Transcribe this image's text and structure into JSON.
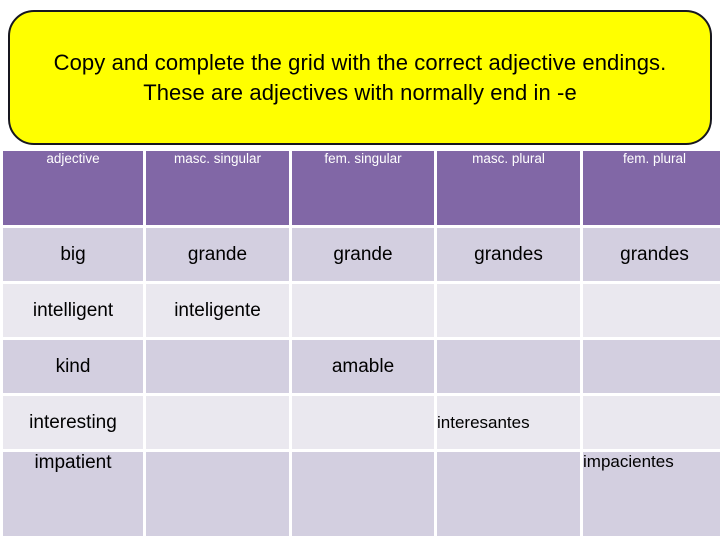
{
  "banner": {
    "text": "Copy and complete the grid with the correct adjective endings. These are adjectives with normally end in -e",
    "background_color": "#ffff00",
    "border_color": "#17171f"
  },
  "table": {
    "header_color": "#8167a6",
    "row_dark_color": "#d3cfe0",
    "row_light_color": "#eae8ef",
    "headers": [
      "adjective",
      "masc. singular",
      "fem. singular",
      "masc. plural",
      "fem. plural"
    ],
    "rows": [
      {
        "adjective": "big",
        "masc_singular": "grande",
        "fem_singular": "grande",
        "masc_plural": "grandes",
        "fem_plural": "grandes"
      },
      {
        "adjective": "intelligent",
        "masc_singular": "inteligente",
        "fem_singular": "",
        "masc_plural": "",
        "fem_plural": ""
      },
      {
        "adjective": "kind",
        "masc_singular": "",
        "fem_singular": "amable",
        "masc_plural": "",
        "fem_plural": ""
      },
      {
        "adjective": "interesting",
        "masc_singular": "",
        "fem_singular": "",
        "masc_plural": "interesantes",
        "fem_plural": ""
      },
      {
        "adjective": "impatient",
        "masc_singular": "",
        "fem_singular": "",
        "masc_plural": "",
        "fem_plural": "impacientes"
      }
    ]
  }
}
